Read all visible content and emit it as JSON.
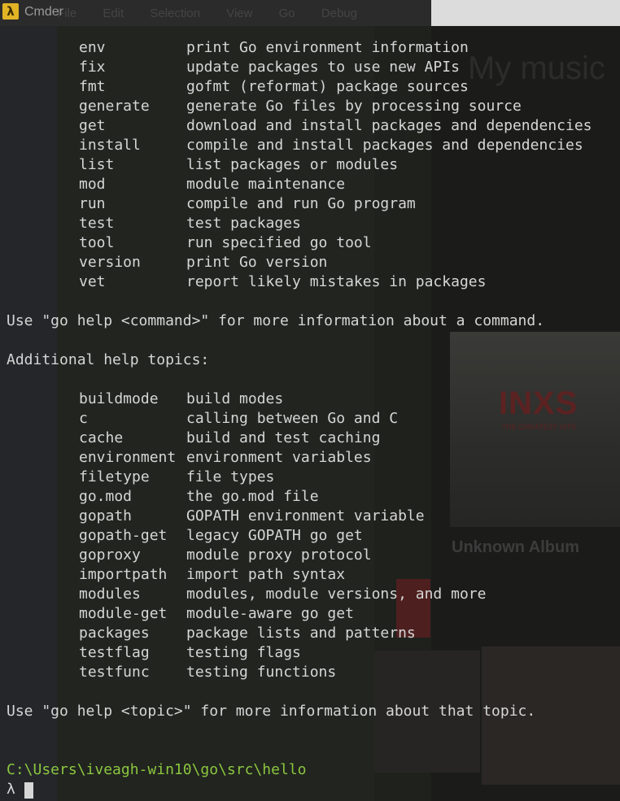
{
  "window": {
    "title": "Cmder",
    "icon": "lambda-app-icon",
    "background_menu": "File Edit Selection View Go Debug"
  },
  "terminal": {
    "commands": [
      {
        "name": "env",
        "desc": "print Go environment information"
      },
      {
        "name": "fix",
        "desc": "update packages to use new APIs"
      },
      {
        "name": "fmt",
        "desc": "gofmt (reformat) package sources"
      },
      {
        "name": "generate",
        "desc": "generate Go files by processing source"
      },
      {
        "name": "get",
        "desc": "download and install packages and dependencies"
      },
      {
        "name": "install",
        "desc": "compile and install packages and dependencies"
      },
      {
        "name": "list",
        "desc": "list packages or modules"
      },
      {
        "name": "mod",
        "desc": "module maintenance"
      },
      {
        "name": "run",
        "desc": "compile and run Go program"
      },
      {
        "name": "test",
        "desc": "test packages"
      },
      {
        "name": "tool",
        "desc": "run specified go tool"
      },
      {
        "name": "version",
        "desc": "print Go version"
      },
      {
        "name": "vet",
        "desc": "report likely mistakes in packages"
      }
    ],
    "usage_command": "Use \"go help <command>\" for more information about a command.",
    "topics_heading": "Additional help topics:",
    "topics": [
      {
        "name": "buildmode",
        "desc": "build modes"
      },
      {
        "name": "c",
        "desc": "calling between Go and C"
      },
      {
        "name": "cache",
        "desc": "build and test caching"
      },
      {
        "name": "environment",
        "desc": "environment variables"
      },
      {
        "name": "filetype",
        "desc": "file types"
      },
      {
        "name": "go.mod",
        "desc": "the go.mod file"
      },
      {
        "name": "gopath",
        "desc": "GOPATH environment variable"
      },
      {
        "name": "gopath-get",
        "desc": "legacy GOPATH go get"
      },
      {
        "name": "goproxy",
        "desc": "module proxy protocol"
      },
      {
        "name": "importpath",
        "desc": "import path syntax"
      },
      {
        "name": "modules",
        "desc": "modules, module versions, and more"
      },
      {
        "name": "module-get",
        "desc": "module-aware go get"
      },
      {
        "name": "packages",
        "desc": "package lists and patterns"
      },
      {
        "name": "testflag",
        "desc": "testing flags"
      },
      {
        "name": "testfunc",
        "desc": "testing functions"
      }
    ],
    "usage_topic": "Use \"go help <topic>\" for more information about that topic.",
    "prompt_path": "C:\\Users\\iveagh-win10\\go\\src\\hello",
    "prompt_symbol": "λ"
  },
  "background": {
    "music_title": "My music",
    "album_art_text": "INXS",
    "album_art_subtitle": "THE GREATEST HITS",
    "album_title": "Unknown Album"
  },
  "colors": {
    "terminal_bg": "#1d1f1c",
    "text": "#d6d6d6",
    "prompt_path": "#8cc63f",
    "app_icon": "#e0b425"
  }
}
